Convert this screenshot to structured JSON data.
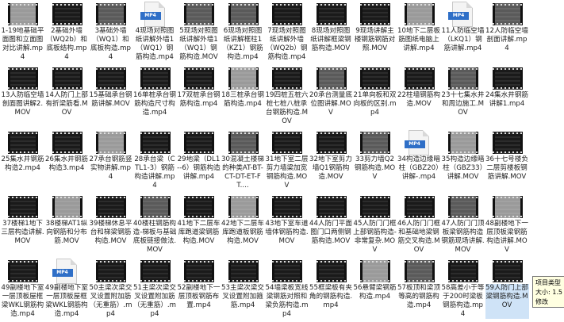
{
  "files": [
    {
      "label": "1-19地基础平面图和立面图对比讲解.mp4",
      "kind": "video",
      "tone": "light"
    },
    {
      "label": "2基础外墙（WQ2b）和底板结构.mp4",
      "kind": "video",
      "tone": "dark"
    },
    {
      "label": "3基础外墙（WQ1）和底板构造.mp4",
      "kind": "video",
      "tone": "mid"
    },
    {
      "label": "4现场对照图纸讲解外墙1（WQ1）钢筋构造.mp4",
      "kind": "doc",
      "badge": "MP4"
    },
    {
      "label": "5现场对照图纸讲解外墙1（WQ1）钢筋构造.MOV",
      "kind": "video",
      "tone": "mid"
    },
    {
      "label": "6现场对照图纸讲解框柱1（KZ1）钢筋构造.mp4",
      "kind": "video",
      "tone": "mid"
    },
    {
      "label": "7现场对照图纸讲解外墙（WQ2b）钢筋构造.mp4",
      "kind": "video",
      "tone": "dark"
    },
    {
      "label": "8现场对照图纸讲解框梁钢筋构造.MOV",
      "kind": "video",
      "tone": "dark"
    },
    {
      "label": "9现场讲解主楼钢筋钢筋对照.MOV",
      "kind": "video",
      "tone": "dark"
    },
    {
      "label": "10地下二层板筋图纸电脑上讲解.mp4",
      "kind": "video",
      "tone": "light"
    },
    {
      "label": "11人防临空墙（LKQ1）钢筋讲解.mp4",
      "kind": "doc",
      "badge": "MP4"
    },
    {
      "label": "12人防临空墙剖面讲解.mp4",
      "kind": "video",
      "tone": "mid"
    },
    {
      "label": "13人防临空墙剖面图讲解2.MOV",
      "kind": "video",
      "tone": "dark"
    },
    {
      "label": "14人防门上部有折梁筋看.MOV",
      "kind": "video",
      "tone": "dark"
    },
    {
      "label": "15基础承台钢筋讲解.MOV",
      "kind": "video",
      "tone": "dark"
    },
    {
      "label": "16单桩承台钢筋构造尺寸构造.mp4",
      "kind": "video",
      "tone": "dark"
    },
    {
      "label": "17双桩承台钢筋构造.mp4",
      "kind": "video",
      "tone": "dark"
    },
    {
      "label": "18三桩承台钢筋构造.mp4",
      "kind": "video",
      "tone": "light"
    },
    {
      "label": "19四桩五桩六桩七桩八桩承台钢筋构造.MOV",
      "kind": "video",
      "tone": "dark"
    },
    {
      "label": "20承台测量底位图讲解.MOV",
      "kind": "video",
      "tone": "mid"
    },
    {
      "label": "21单向板和双向板的区别.mp4",
      "kind": "video",
      "tone": "dark"
    },
    {
      "label": "22柱墙钢筋构造.MOV",
      "kind": "video",
      "tone": "dark"
    },
    {
      "label": "23十七集水井和周边施工.MOV",
      "kind": "video",
      "tone": "mid"
    },
    {
      "label": "24集水井钢筋讲解1.mp4",
      "kind": "video",
      "tone": "dark"
    },
    {
      "label": "25集水井钢筋构造2.mp4",
      "kind": "video",
      "tone": "dark"
    },
    {
      "label": "26集水井钢筋构造3.mp4",
      "kind": "video",
      "tone": "dark"
    },
    {
      "label": "27承台钢筋竖实物讲解.mp4",
      "kind": "video",
      "tone": "light"
    },
    {
      "label": "28承台梁（CTL1-3）钢筋构造讲解.mp4",
      "kind": "video",
      "tone": "dark"
    },
    {
      "label": "29地梁（DL1--6）钢筋构造讲解.mp4",
      "kind": "video",
      "tone": "dark"
    },
    {
      "label": "30混凝土楼梯的种类AT-BT-CT-DT-ET-FT....",
      "kind": "video",
      "tone": "mid"
    },
    {
      "label": "31地下室二层剪力墙梁加宽钢筋构造.MOV",
      "kind": "video",
      "tone": "dark"
    },
    {
      "label": "32地下室剪力墙Q1钢筋构造.MOV",
      "kind": "video",
      "tone": "dark"
    },
    {
      "label": "33剪力墙Q2钢筋构造.MOV",
      "kind": "video",
      "tone": "mid"
    },
    {
      "label": "34构造边缘暗柱（GBZ20）讲解-.mp4",
      "kind": "doc",
      "badge": "MP4"
    },
    {
      "label": "35构造边缘暗柱（GBZ33）讲解.MOV",
      "kind": "video",
      "tone": "light"
    },
    {
      "label": "36十七号楼负二层剪楼板钢筋讲解.MOV",
      "kind": "video",
      "tone": "dark"
    },
    {
      "label": "37楼梯1地下三层构造讲解.MOV",
      "kind": "video",
      "tone": "dark"
    },
    {
      "label": "38楼梯AT1纵向钢筋和分布筋.MOV",
      "kind": "video",
      "tone": "light"
    },
    {
      "label": "39楼梯休息平台和梯梁钢筋构造.MOV",
      "kind": "video",
      "tone": "dark"
    },
    {
      "label": "40楼柱钢筋构造-梯板与基础底板链接做法.MOV",
      "kind": "video",
      "tone": "mid"
    },
    {
      "label": "41地下二层车库跑道梁钢筋构造.MOV",
      "kind": "video",
      "tone": "dark"
    },
    {
      "label": "42地下二层车库跑道板钢筋构造.MOV",
      "kind": "video",
      "tone": "light"
    },
    {
      "label": "43地下室车道墙体钢筋构造.MOV",
      "kind": "video",
      "tone": "dark"
    },
    {
      "label": "44人防门平面图门口两侧钢筋构造.MOV",
      "kind": "video",
      "tone": "dark"
    },
    {
      "label": "45人防门门框上部钢筋构造-非常复杂.MOV",
      "kind": "video",
      "tone": "dark"
    },
    {
      "label": "46人防门门框和基础地梁钢筋交叉构造.MOV",
      "kind": "video",
      "tone": "dark"
    },
    {
      "label": "47人防门门顶板梁钢筋构造钢筋现场讲解.MOV",
      "kind": "video",
      "tone": "mid"
    },
    {
      "label": "48副楼地下一层顶板梁钢筋构造讲解.MOV",
      "kind": "video",
      "tone": "light"
    },
    {
      "label": "49副楼地下室一层顶板屋框梁WKL钢筋构造.mp4",
      "kind": "video",
      "tone": "dark"
    },
    {
      "label": "49副楼地下室一层顶板屋框梁WKL钢筋构造.mp4",
      "kind": "doc",
      "badge": "MP4"
    },
    {
      "label": "50主梁次梁交叉设置附加筋（无重筋）.mp4",
      "kind": "video",
      "tone": "dark"
    },
    {
      "label": "51主梁次梁交叉设置附加筋（无重筋）.mp4",
      "kind": "video",
      "tone": "dark"
    },
    {
      "label": "52副楼地下一层顶板钢筋布置.mp4",
      "kind": "video",
      "tone": "dark"
    },
    {
      "label": "53主梁次梁交叉设置附加箍筋.mp4",
      "kind": "video",
      "tone": "dark"
    },
    {
      "label": "54墙梁板宽线梁钢筋对照和梁负筋构造.mp4",
      "kind": "video",
      "tone": "dark"
    },
    {
      "label": "55框梁板有夹角的钢筋构造.mp4",
      "kind": "video",
      "tone": "dark"
    },
    {
      "label": "56悬臂梁钢筋构造.mp4",
      "kind": "video",
      "tone": "light"
    },
    {
      "label": "57板顶和梁顶等高的钢筋构造.mp4",
      "kind": "video",
      "tone": "mid"
    },
    {
      "label": "58高差小于等于200时梁板钢筋构造.mp4",
      "kind": "video",
      "tone": "dark"
    },
    {
      "label": "59人防门上部梁钢筋构造.MOV",
      "kind": "video",
      "tone": "dark"
    }
  ],
  "tooltip": {
    "line1": "项目类型",
    "line2": "大小: 1.5",
    "line3": "修改"
  }
}
